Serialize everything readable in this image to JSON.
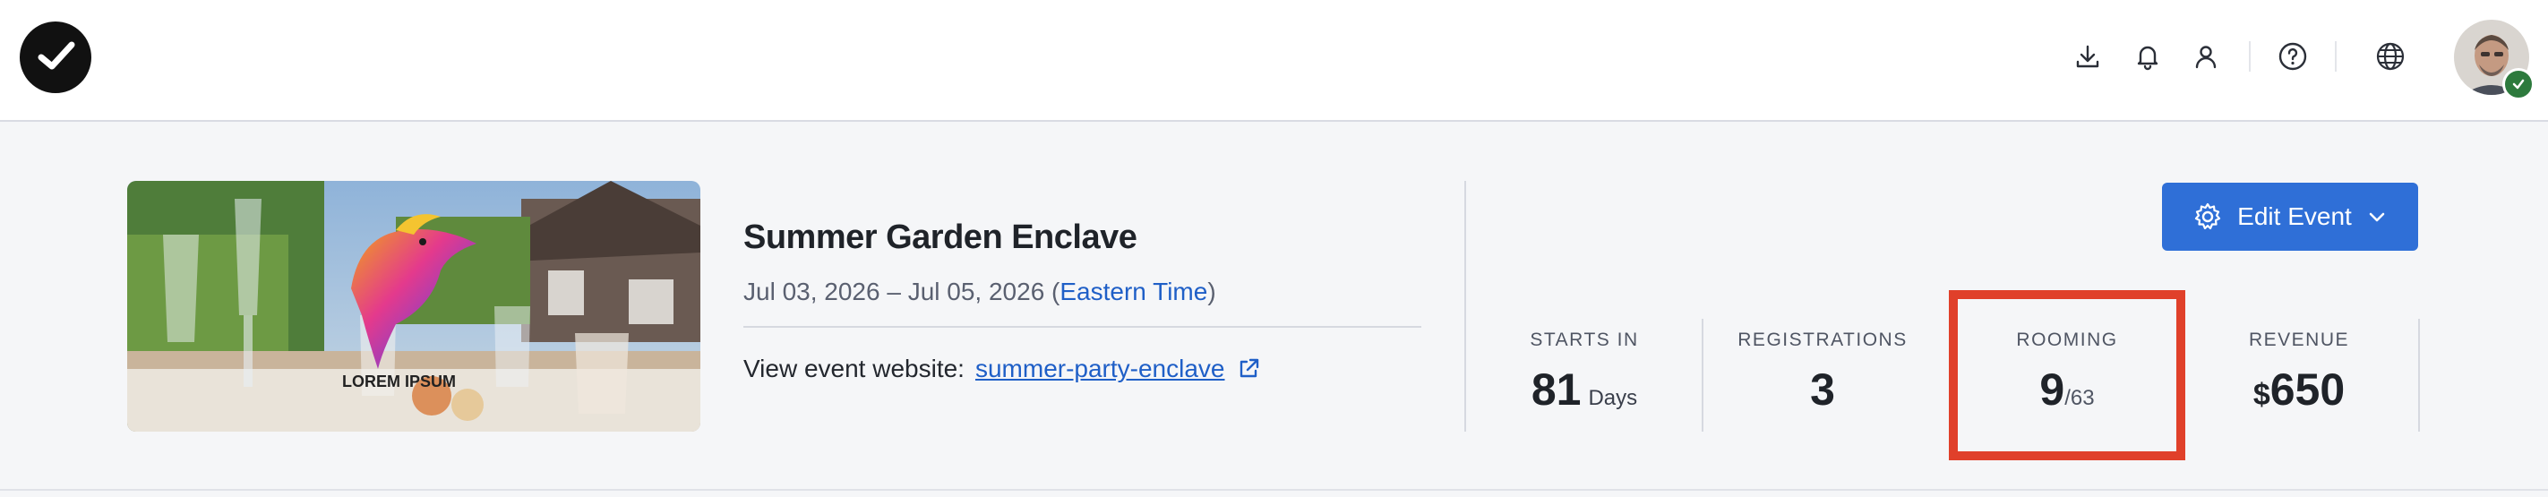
{
  "header": {
    "icons": [
      "download-icon",
      "bell-icon",
      "user-icon",
      "help-icon",
      "globe-icon"
    ],
    "avatar_badge_color": "#2d7a3d"
  },
  "event": {
    "title": "Summer Garden Enclave",
    "dates": "Jul 03, 2026 – Jul 05, 2026 (",
    "timezone": "Eastern Time",
    "dates_close": ")",
    "website_label": "View event website:",
    "website_link": "summer-party-enclave",
    "hero_logo_text": "LOREM IPSUM"
  },
  "actions": {
    "edit_label": "Edit Event",
    "accent_color": "#2f6fd7"
  },
  "stats": {
    "starts_in": {
      "label": "STARTS IN",
      "value": "81",
      "unit": "Days"
    },
    "registrations": {
      "label": "REGISTRATIONS",
      "value": "3"
    },
    "rooming": {
      "label": "ROOMING",
      "value": "9",
      "denominator": "/63"
    },
    "revenue": {
      "label": "REVENUE",
      "currency": "$",
      "value": "650"
    }
  },
  "highlight_color": "#e0402a"
}
